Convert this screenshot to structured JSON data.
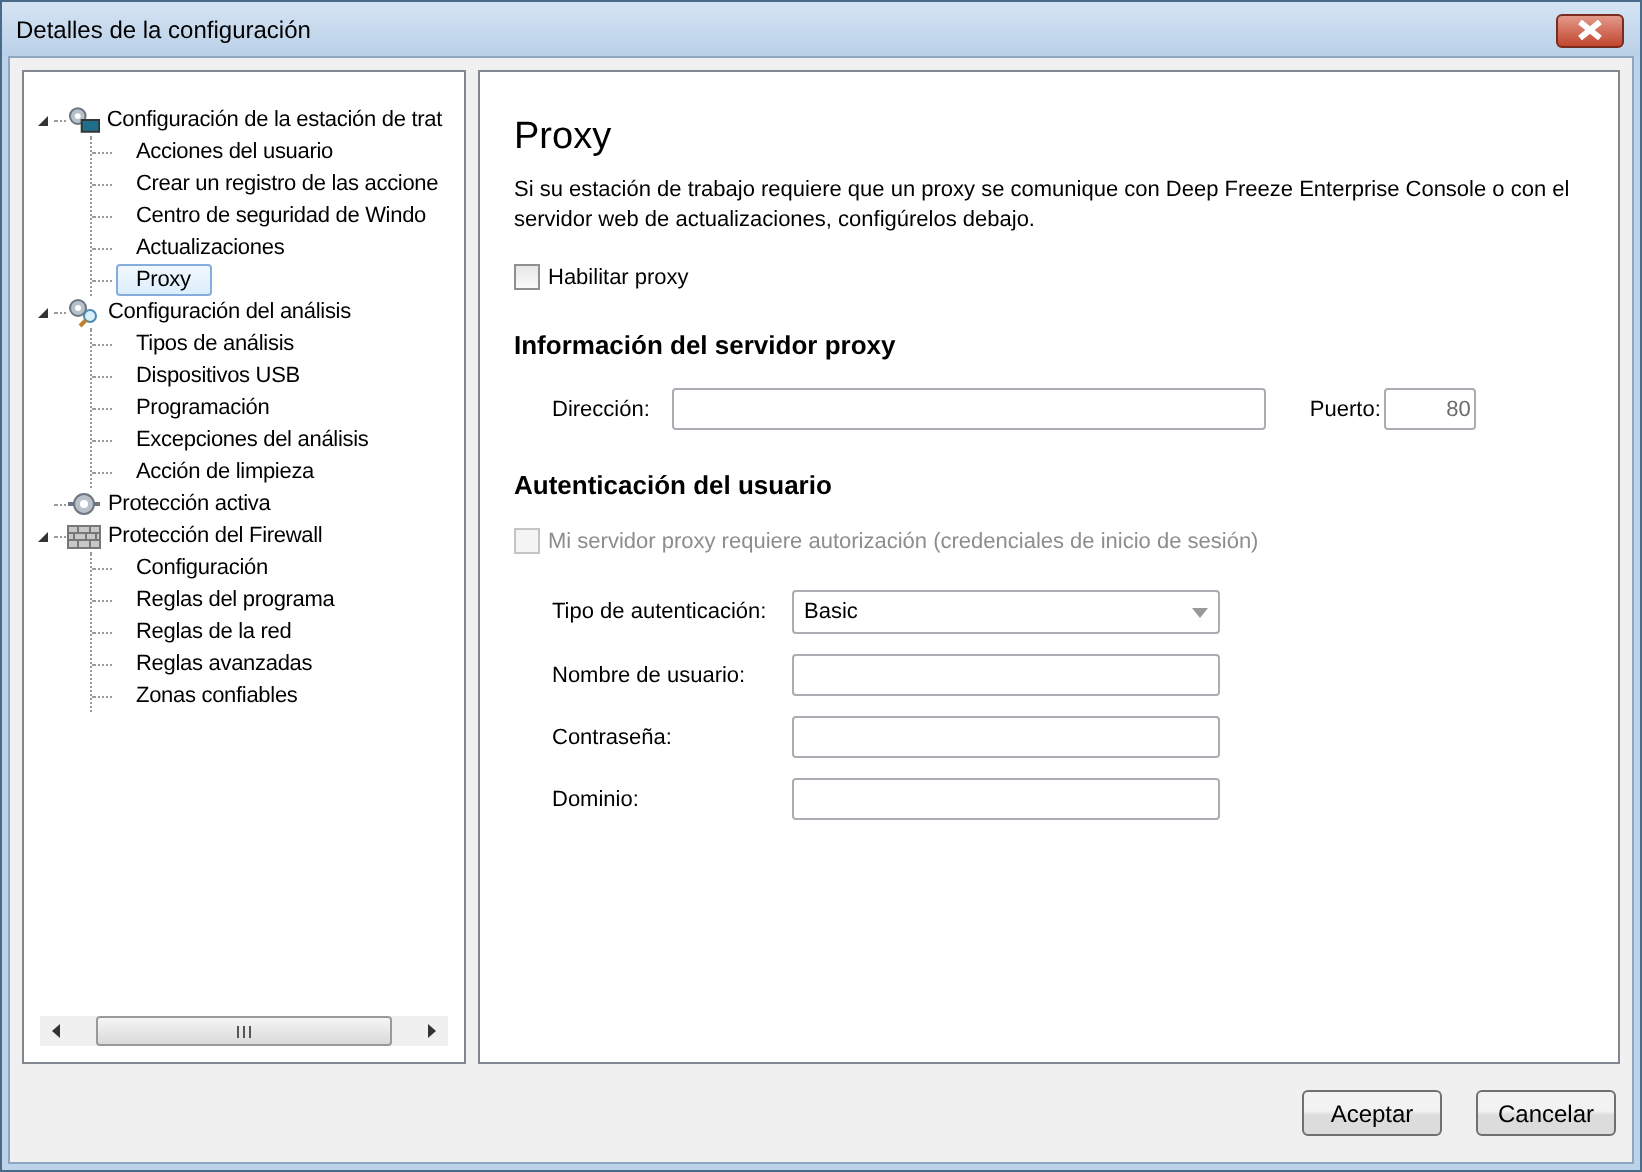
{
  "window": {
    "title": "Detalles de la configuración"
  },
  "tree": [
    {
      "label": "Configuración de la estación de trat",
      "kind": "workstation",
      "expanded": true,
      "selected": false,
      "children": [
        {
          "label": "Acciones del usuario",
          "selected": false
        },
        {
          "label": "Crear un registro de las accione",
          "selected": false
        },
        {
          "label": "Centro de seguridad de Windo",
          "selected": false
        },
        {
          "label": "Actualizaciones",
          "selected": false
        },
        {
          "label": "Proxy",
          "selected": true
        }
      ]
    },
    {
      "label": "Configuración del análisis",
      "kind": "scan",
      "expanded": true,
      "selected": false,
      "children": [
        {
          "label": "Tipos de análisis",
          "selected": false
        },
        {
          "label": "Dispositivos USB",
          "selected": false
        },
        {
          "label": "Programación",
          "selected": false
        },
        {
          "label": "Excepciones del análisis",
          "selected": false
        },
        {
          "label": "Acción de limpieza",
          "selected": false
        }
      ]
    },
    {
      "label": "Protección activa",
      "kind": "plug",
      "selected": false
    },
    {
      "label": "Protección del Firewall",
      "kind": "firewall",
      "expanded": true,
      "selected": false,
      "children": [
        {
          "label": "Configuración",
          "selected": false
        },
        {
          "label": "Reglas del  programa",
          "selected": false
        },
        {
          "label": "Reglas de la red",
          "selected": false
        },
        {
          "label": "Reglas avanzadas",
          "selected": false
        },
        {
          "label": "Zonas confiables",
          "selected": false
        }
      ]
    }
  ],
  "panel": {
    "title": "Proxy",
    "description": " Si su estación de trabajo requiere que un proxy se comunique con Deep Freeze Enterprise Console o con el servidor web de actualizaciones, configúrelos debajo.",
    "enable": {
      "label": "Habilitar proxy",
      "checked": false,
      "disabled": false
    },
    "server_heading": "Información del servidor proxy",
    "address": {
      "label": "Dirección:"
    },
    "port": {
      "label": "Puerto:",
      "value": "80"
    },
    "auth_heading": "Autenticación del usuario",
    "auth_required": {
      "label": "Mi servidor proxy requiere autorización (credenciales de inicio de sesión)",
      "checked": false,
      "disabled": true
    },
    "auth_fields": [
      {
        "kind": "dropdown",
        "label": "Tipo de autenticación:",
        "value": "Basic"
      },
      {
        "kind": "text",
        "label": "Nombre de usuario:"
      },
      {
        "kind": "text",
        "label": "Contraseña:"
      },
      {
        "kind": "text",
        "label": "Dominio:"
      }
    ]
  },
  "buttons": [
    "Aceptar",
    "Cancelar"
  ]
}
